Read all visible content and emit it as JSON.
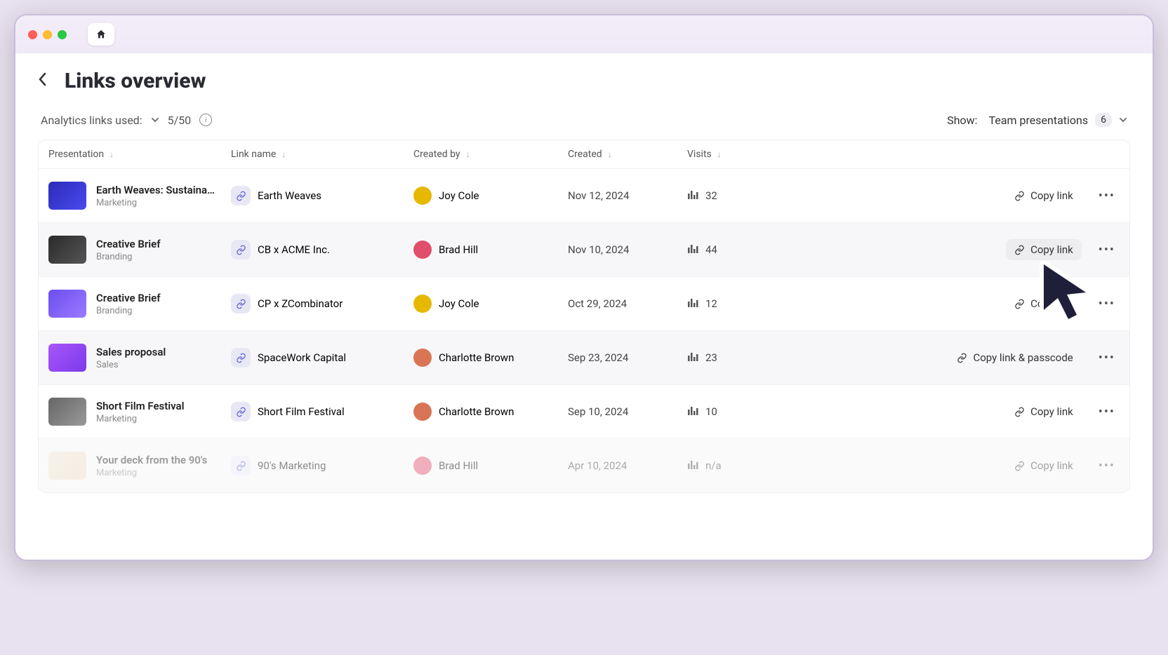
{
  "header": {
    "title": "Links overview",
    "analytics_label": "Analytics links used:",
    "analytics_used": "5/50",
    "show_label": "Show:",
    "filter_option": "Team presentations",
    "filter_count": "6"
  },
  "columns": {
    "presentation": "Presentation",
    "link_name": "Link name",
    "created_by": "Created by",
    "created": "Created",
    "visits": "Visits"
  },
  "rows": [
    {
      "title": "Earth Weaves: Sustainabl...",
      "category": "Marketing",
      "thumb_bg": "linear-gradient(135deg,#2b2bb8,#4a4af0)",
      "link_name": "Earth Weaves",
      "user": "Joy Cole",
      "avatar_bg": "#e6b800",
      "created": "Nov 12, 2024",
      "visits": "32",
      "copy_label": "Copy link",
      "hovered": false,
      "faded": false
    },
    {
      "title": "Creative Brief",
      "category": "Branding",
      "thumb_bg": "linear-gradient(135deg,#2a2a2a,#555)",
      "link_name": "CB x ACME Inc.",
      "user": "Brad Hill",
      "avatar_bg": "#e04f6b",
      "created": "Nov 10, 2024",
      "visits": "44",
      "copy_label": "Copy link",
      "hovered": true,
      "faded": false
    },
    {
      "title": "Creative Brief",
      "category": "Branding",
      "thumb_bg": "linear-gradient(135deg,#6b4ef0,#9b7bff)",
      "link_name": "CP x ZCombinator",
      "user": "Joy Cole",
      "avatar_bg": "#e6b800",
      "created": "Oct 29, 2024",
      "visits": "12",
      "copy_label": "Copy link",
      "hovered": false,
      "faded": false
    },
    {
      "title": "Sales proposal",
      "category": "Sales",
      "thumb_bg": "linear-gradient(135deg,#a855f7,#7c3aed)",
      "link_name": "SpaceWork Capital",
      "user": "Charlotte Brown",
      "avatar_bg": "#d97555",
      "created": "Sep 23, 2024",
      "visits": "23",
      "copy_label": "Copy link & passcode",
      "hovered": true,
      "faded": false
    },
    {
      "title": "Short Film Festival",
      "category": "Marketing",
      "thumb_bg": "linear-gradient(135deg,#666,#999)",
      "link_name": "Short Film Festival",
      "user": "Charlotte Brown",
      "avatar_bg": "#d97555",
      "created": "Sep 10, 2024",
      "visits": "10",
      "copy_label": "Copy link",
      "hovered": false,
      "faded": false
    },
    {
      "title": "Your deck from the 90's",
      "category": "Marketing",
      "thumb_bg": "linear-gradient(135deg,#f0e0d0,#e8d8c0)",
      "link_name": "90's Marketing",
      "user": "Brad Hill",
      "avatar_bg": "#e04f6b",
      "created": "Apr 10, 2024",
      "visits": "n/a",
      "copy_label": "Copy link",
      "hovered": false,
      "faded": true
    }
  ]
}
